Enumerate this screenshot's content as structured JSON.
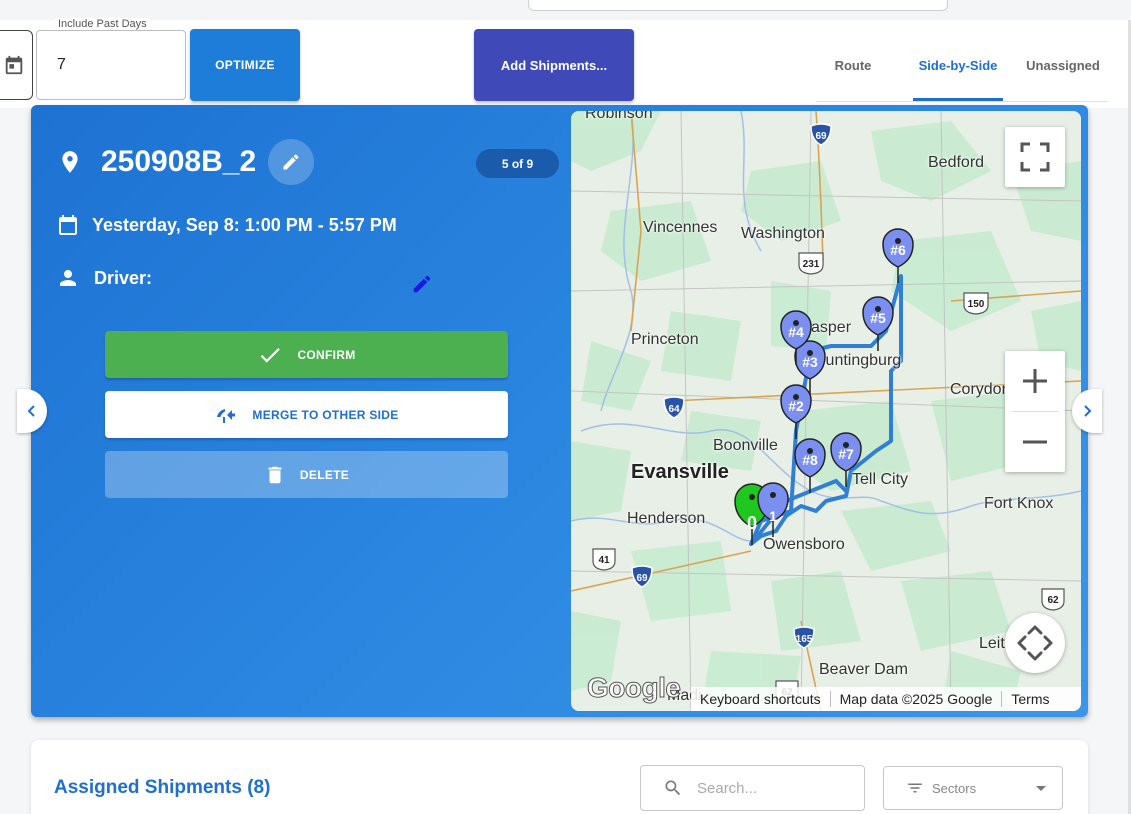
{
  "toolbar": {
    "include_past_days_label": "Include Past Days",
    "include_past_days_value": "7",
    "optimize_label": "OPTIMIZE",
    "add_shipments_label": "Add Shipments..."
  },
  "tabs": [
    {
      "label": "Route",
      "active": false
    },
    {
      "label": "Side-by-Side",
      "active": true
    },
    {
      "label": "Unassigned",
      "active": false
    }
  ],
  "route": {
    "name": "250908B_2",
    "counter": "5 of 9",
    "date_range": "Yesterday, Sep 8: 1:00 PM - 5:57 PM",
    "driver_label": "Driver:",
    "confirm_label": "CONFIRM",
    "merge_label": "MERGE TO OTHER SIDE",
    "delete_label": "DELETE"
  },
  "map": {
    "place_labels": [
      "Robinson",
      "Bedford",
      "Vincennes",
      "Washington",
      "Jasper",
      "Huntingburg",
      "Princeton",
      "Corydon",
      "Boonville",
      "Evansville",
      "Tell City",
      "Henderson",
      "Owensboro",
      "Fort Knox",
      "Beaver Dam",
      "Leit",
      "Madi"
    ],
    "highway_shields": [
      "69",
      "231",
      "150",
      "64",
      "41",
      "69",
      "165",
      "62",
      "62"
    ],
    "markers": [
      {
        "label": "0",
        "color": "#1ec81e"
      },
      {
        "label": "1",
        "color": "#7a8ff0"
      },
      {
        "label": "#2",
        "color": "#7a8ff0"
      },
      {
        "label": "#3",
        "color": "#7a8ff0"
      },
      {
        "label": "#4",
        "color": "#7a8ff0"
      },
      {
        "label": "#5",
        "color": "#7a8ff0"
      },
      {
        "label": "#6",
        "color": "#7a8ff0"
      },
      {
        "label": "#7",
        "color": "#7a8ff0"
      },
      {
        "label": "#8",
        "color": "#7a8ff0"
      }
    ],
    "route_color": "#2f7fd6",
    "google_logo": "Google",
    "footer": {
      "shortcuts": "Keyboard shortcuts",
      "map_data": "Map data ©2025 Google",
      "terms": "Terms"
    }
  },
  "assigned": {
    "title": "Assigned Shipments (8)",
    "search_placeholder": "Search...",
    "sectors_label": "Sectors"
  },
  "colors": {
    "primary": "#1e7dd8",
    "indigo": "#3f4ab8",
    "confirm_green": "#4caf50",
    "tab_active": "#1e6fd0"
  },
  "icons": {
    "calendar": "calendar-icon",
    "location": "location-pin-icon",
    "edit": "pencil-icon",
    "person": "person-icon",
    "check": "check-icon",
    "merge": "merge-arrow-icon",
    "trash": "trash-icon",
    "search": "search-icon",
    "filter": "filter-icon"
  }
}
